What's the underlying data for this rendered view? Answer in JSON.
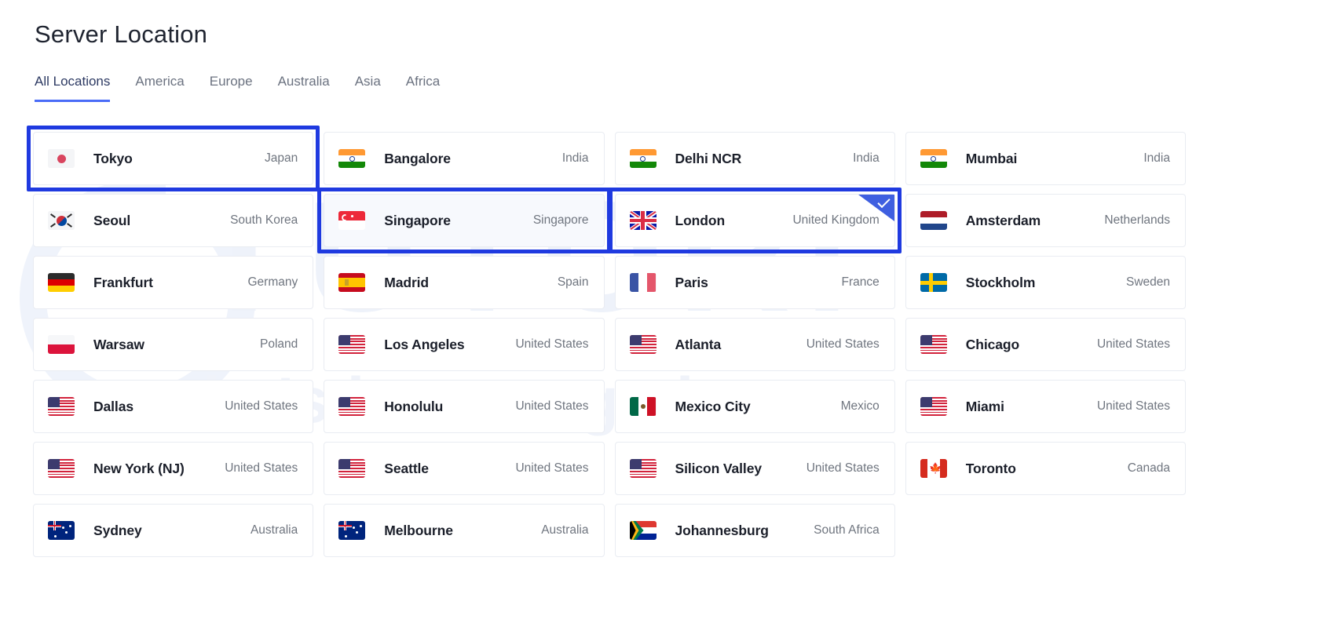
{
  "page": {
    "title": "Server Location",
    "watermark_main": "TUTORI",
    "watermark_sub": "let's learn together"
  },
  "tabs": [
    {
      "label": "All Locations",
      "active": true
    },
    {
      "label": "America",
      "active": false
    },
    {
      "label": "Europe",
      "active": false
    },
    {
      "label": "Australia",
      "active": false
    },
    {
      "label": "Asia",
      "active": false
    },
    {
      "label": "Africa",
      "active": false
    }
  ],
  "colors": {
    "highlight_border": "#1f3ae0",
    "tab_underline": "#4a6cf7",
    "check_badge": "#3f5fe0",
    "card_border": "#e9ecf2",
    "city_text": "#1b1f2a",
    "country_text": "#6f757f"
  },
  "locations": [
    {
      "city": "Tokyo",
      "country": "Japan",
      "flag": "jp",
      "highlight": true,
      "selected": false,
      "checked": false
    },
    {
      "city": "Bangalore",
      "country": "India",
      "flag": "in",
      "highlight": false,
      "selected": false,
      "checked": false
    },
    {
      "city": "Delhi NCR",
      "country": "India",
      "flag": "in",
      "highlight": false,
      "selected": false,
      "checked": false
    },
    {
      "city": "Mumbai",
      "country": "India",
      "flag": "in",
      "highlight": false,
      "selected": false,
      "checked": false
    },
    {
      "city": "Seoul",
      "country": "South Korea",
      "flag": "kr",
      "highlight": false,
      "selected": false,
      "checked": false
    },
    {
      "city": "Singapore",
      "country": "Singapore",
      "flag": "sg",
      "highlight": true,
      "selected": true,
      "checked": false
    },
    {
      "city": "London",
      "country": "United Kingdom",
      "flag": "gb",
      "highlight": true,
      "selected": false,
      "checked": true
    },
    {
      "city": "Amsterdam",
      "country": "Netherlands",
      "flag": "nl",
      "highlight": false,
      "selected": false,
      "checked": false
    },
    {
      "city": "Frankfurt",
      "country": "Germany",
      "flag": "de",
      "highlight": false,
      "selected": false,
      "checked": false
    },
    {
      "city": "Madrid",
      "country": "Spain",
      "flag": "es",
      "highlight": false,
      "selected": false,
      "checked": false
    },
    {
      "city": "Paris",
      "country": "France",
      "flag": "fr",
      "highlight": false,
      "selected": false,
      "checked": false
    },
    {
      "city": "Stockholm",
      "country": "Sweden",
      "flag": "se",
      "highlight": false,
      "selected": false,
      "checked": false
    },
    {
      "city": "Warsaw",
      "country": "Poland",
      "flag": "pl",
      "highlight": false,
      "selected": false,
      "checked": false
    },
    {
      "city": "Los Angeles",
      "country": "United States",
      "flag": "us",
      "highlight": false,
      "selected": false,
      "checked": false
    },
    {
      "city": "Atlanta",
      "country": "United States",
      "flag": "us",
      "highlight": false,
      "selected": false,
      "checked": false
    },
    {
      "city": "Chicago",
      "country": "United States",
      "flag": "us",
      "highlight": false,
      "selected": false,
      "checked": false
    },
    {
      "city": "Dallas",
      "country": "United States",
      "flag": "us",
      "highlight": false,
      "selected": false,
      "checked": false
    },
    {
      "city": "Honolulu",
      "country": "United States",
      "flag": "us",
      "highlight": false,
      "selected": false,
      "checked": false
    },
    {
      "city": "Mexico City",
      "country": "Mexico",
      "flag": "mx",
      "highlight": false,
      "selected": false,
      "checked": false
    },
    {
      "city": "Miami",
      "country": "United States",
      "flag": "us",
      "highlight": false,
      "selected": false,
      "checked": false
    },
    {
      "city": "New York (NJ)",
      "country": "United States",
      "flag": "us",
      "highlight": false,
      "selected": false,
      "checked": false
    },
    {
      "city": "Seattle",
      "country": "United States",
      "flag": "us",
      "highlight": false,
      "selected": false,
      "checked": false
    },
    {
      "city": "Silicon Valley",
      "country": "United States",
      "flag": "us",
      "highlight": false,
      "selected": false,
      "checked": false
    },
    {
      "city": "Toronto",
      "country": "Canada",
      "flag": "ca",
      "highlight": false,
      "selected": false,
      "checked": false
    },
    {
      "city": "Sydney",
      "country": "Australia",
      "flag": "au",
      "highlight": false,
      "selected": false,
      "checked": false
    },
    {
      "city": "Melbourne",
      "country": "Australia",
      "flag": "au",
      "highlight": false,
      "selected": false,
      "checked": false
    },
    {
      "city": "Johannesburg",
      "country": "South Africa",
      "flag": "za",
      "highlight": false,
      "selected": false,
      "checked": false
    }
  ]
}
